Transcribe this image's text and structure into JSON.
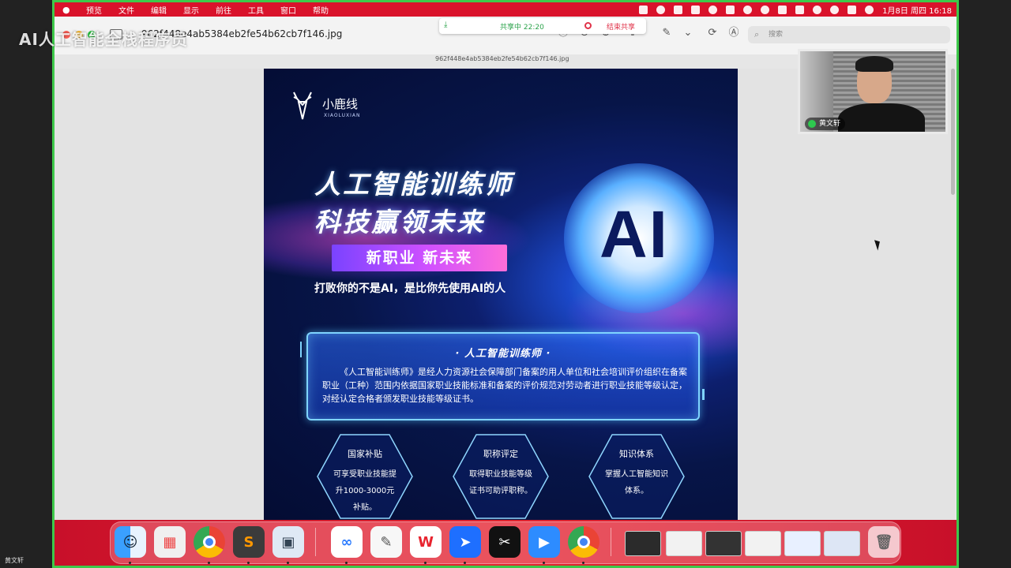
{
  "overlay": {
    "watermark_title": "AI人工智能全栈程序员"
  },
  "menubar": {
    "items": [
      "预览",
      "文件",
      "编辑",
      "显示",
      "前往",
      "工具",
      "窗口",
      "帮助"
    ],
    "clock": "1月8日 周四 16:18"
  },
  "window": {
    "title": "962f448e4ab5384eb2fe54b62cb7f146.jpg",
    "subtitle": "962f448e4ab5384eb2fe54b62cb7f146.jpg",
    "search_placeholder": "搜索"
  },
  "share_bar": {
    "status": "共享中 22:20",
    "stop_label": "结束共享"
  },
  "poster": {
    "brand_cn": "小鹿线",
    "brand_en": "XIAOLUXIAN",
    "headline_1": "人工智能训练师",
    "headline_2": "科技赢领未来",
    "ai_mark": "AI",
    "tag": "新职业 新未来",
    "slogan": "打败你的不是AI，是比你先使用AI的人",
    "intro_title": "· 人工智能训练师 ·",
    "intro_body": "《人工智能训练师》是经人力资源社会保障部门备案的用人单位和社会培训评价组织在备案职业（工种）范围内依据国家职业技能标准和备案的评价规范对劳动者进行职业技能等级认定，对经认定合格者颁发职业技能等级证书。",
    "features": [
      {
        "title": "国家补贴",
        "body": "可享受职业技能提升1000-3000元补贴。"
      },
      {
        "title": "职称评定",
        "body": "取得职业技能等级证书可助评职称。"
      },
      {
        "title": "知识体系",
        "body": "掌握人工智能知识体系。"
      }
    ]
  },
  "webcam": {
    "name": "黄文轩"
  },
  "corner_label": "黄文轩",
  "dock": {
    "apps": [
      "finder-icon",
      "launchpad-icon",
      "chrome-icon",
      "sublime-icon",
      "preview-icon",
      "baidu-netdisk-icon",
      "textedit-icon",
      "wps-icon",
      "feishu-icon",
      "capcut-icon",
      "zoom-icon",
      "chrome-icon",
      "trash-icon"
    ]
  },
  "colors": {
    "share_green": "#3ec94a",
    "menubar_red": "#d9122b",
    "accent_pink": "#d050ff"
  }
}
